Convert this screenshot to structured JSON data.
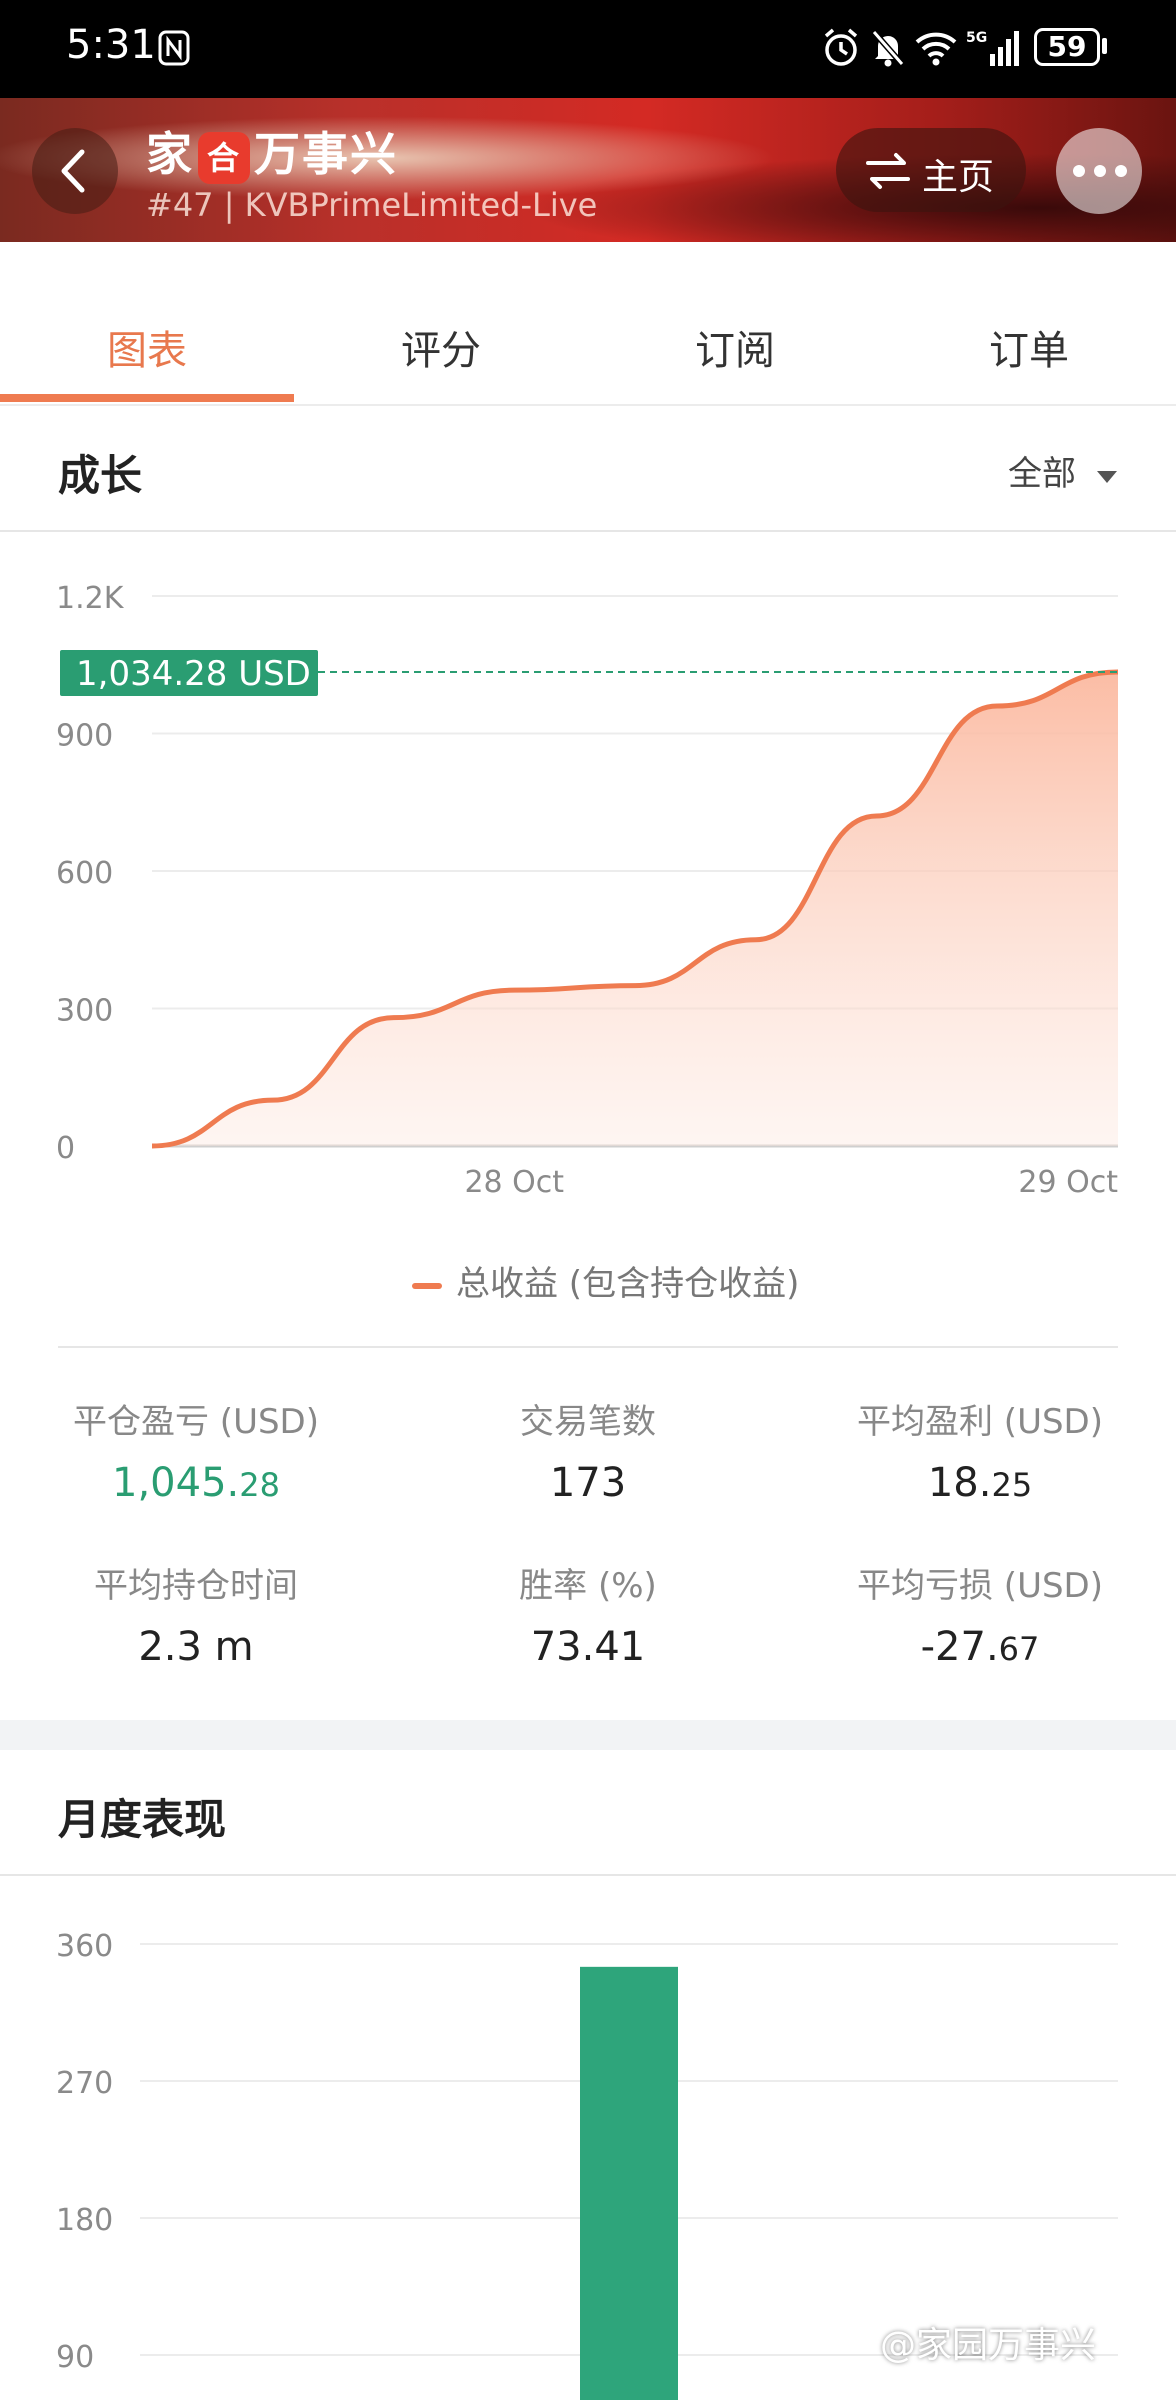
{
  "status_bar": {
    "time": "5:31",
    "battery": "59",
    "icons": [
      "nfc-icon",
      "alarm-icon",
      "mute-icon",
      "wifi-icon",
      "signal-5g-icon",
      "battery-icon"
    ]
  },
  "header": {
    "title_left": "家",
    "title_mid": "合",
    "title_right": "万事兴",
    "subtitle": "#47 | KVBPrimeLimited-Live",
    "home_label": "主页"
  },
  "tabs": [
    {
      "label": "图表",
      "active": true
    },
    {
      "label": "评分",
      "active": false
    },
    {
      "label": "订阅",
      "active": false
    },
    {
      "label": "订单",
      "active": false
    }
  ],
  "growth": {
    "title": "成长",
    "filter": "全部",
    "current_value_label": "1,034.28 USD",
    "legend": "总收益 (包含持仓收益)"
  },
  "stats": [
    {
      "label": "平仓盈亏 (USD)",
      "int": "1,045.",
      "frac": "28",
      "color": "green"
    },
    {
      "label": "交易笔数",
      "int": "173",
      "frac": "",
      "color": "default"
    },
    {
      "label": "平均盈利 (USD)",
      "int": "18.",
      "frac": "25",
      "color": "default"
    },
    {
      "label": "平均持仓时间",
      "int": "2.3 m",
      "frac": "",
      "color": "default"
    },
    {
      "label": "胜率 (%)",
      "int": "73.41",
      "frac": "",
      "color": "default"
    },
    {
      "label": "平均亏损 (USD)",
      "int": "-27.",
      "frac": "67",
      "color": "default"
    }
  ],
  "monthly": {
    "title": "月度表现"
  },
  "chart_data": [
    {
      "type": "area",
      "series": [
        {
          "name": "总收益 (包含持仓收益)",
          "values": [
            0,
            100,
            280,
            340,
            350,
            450,
            720,
            960,
            1034.28
          ]
        }
      ],
      "x": [
        "",
        "",
        "",
        "28 Oct",
        "",
        "",
        "",
        "",
        "29 Oct"
      ],
      "x_tick_labels": [
        "28 Oct",
        "29 Oct"
      ],
      "y_ticks": [
        0,
        300,
        600,
        900,
        "1.2K"
      ],
      "ylim": [
        0,
        1200
      ],
      "reference_value": 1034.28,
      "colors": {
        "line": "#ef7b50",
        "fill": "#fbc9b6",
        "reference": "#2a9d72"
      }
    },
    {
      "type": "bar",
      "values": [
        345
      ],
      "y_ticks": [
        90,
        180,
        270,
        360
      ],
      "ylim": [
        0,
        360
      ],
      "colors": {
        "bar": "#2ea57b"
      }
    }
  ],
  "watermark": "@家园万事兴"
}
